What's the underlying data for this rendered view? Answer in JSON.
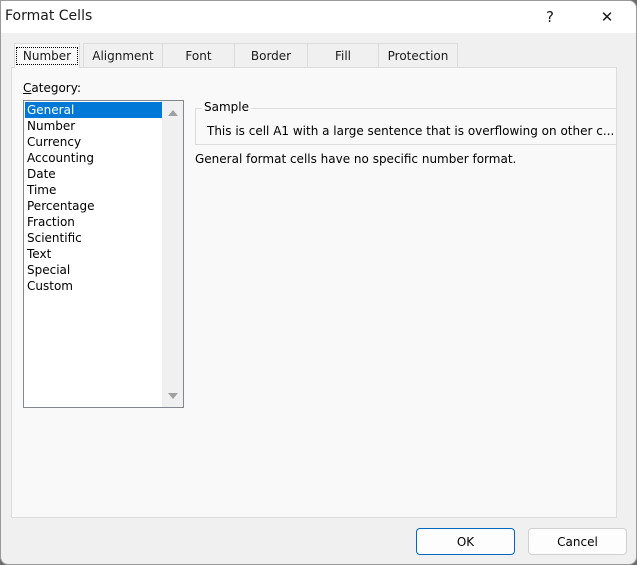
{
  "window": {
    "title": "Format Cells",
    "help_label": "?",
    "close_label": "✕"
  },
  "tabs": [
    {
      "label": "Number",
      "active": true
    },
    {
      "label": "Alignment",
      "active": false
    },
    {
      "label": "Font",
      "active": false
    },
    {
      "label": "Border",
      "active": false
    },
    {
      "label": "Fill",
      "active": false
    },
    {
      "label": "Protection",
      "active": false
    }
  ],
  "category": {
    "label_accel": "C",
    "label_rest": "ategory:",
    "items": [
      "General",
      "Number",
      "Currency",
      "Accounting",
      "Date",
      "Time",
      "Percentage",
      "Fraction",
      "Scientific",
      "Text",
      "Special",
      "Custom"
    ],
    "selected": "General"
  },
  "sample": {
    "legend": "Sample",
    "text": "This is cell A1 with a large sentence that is overflowing on other c..."
  },
  "description": "General format cells have no specific number format.",
  "buttons": {
    "ok": "OK",
    "cancel": "Cancel"
  },
  "colors": {
    "selection": "#0078d7",
    "default_button_border": "#0067c0"
  }
}
